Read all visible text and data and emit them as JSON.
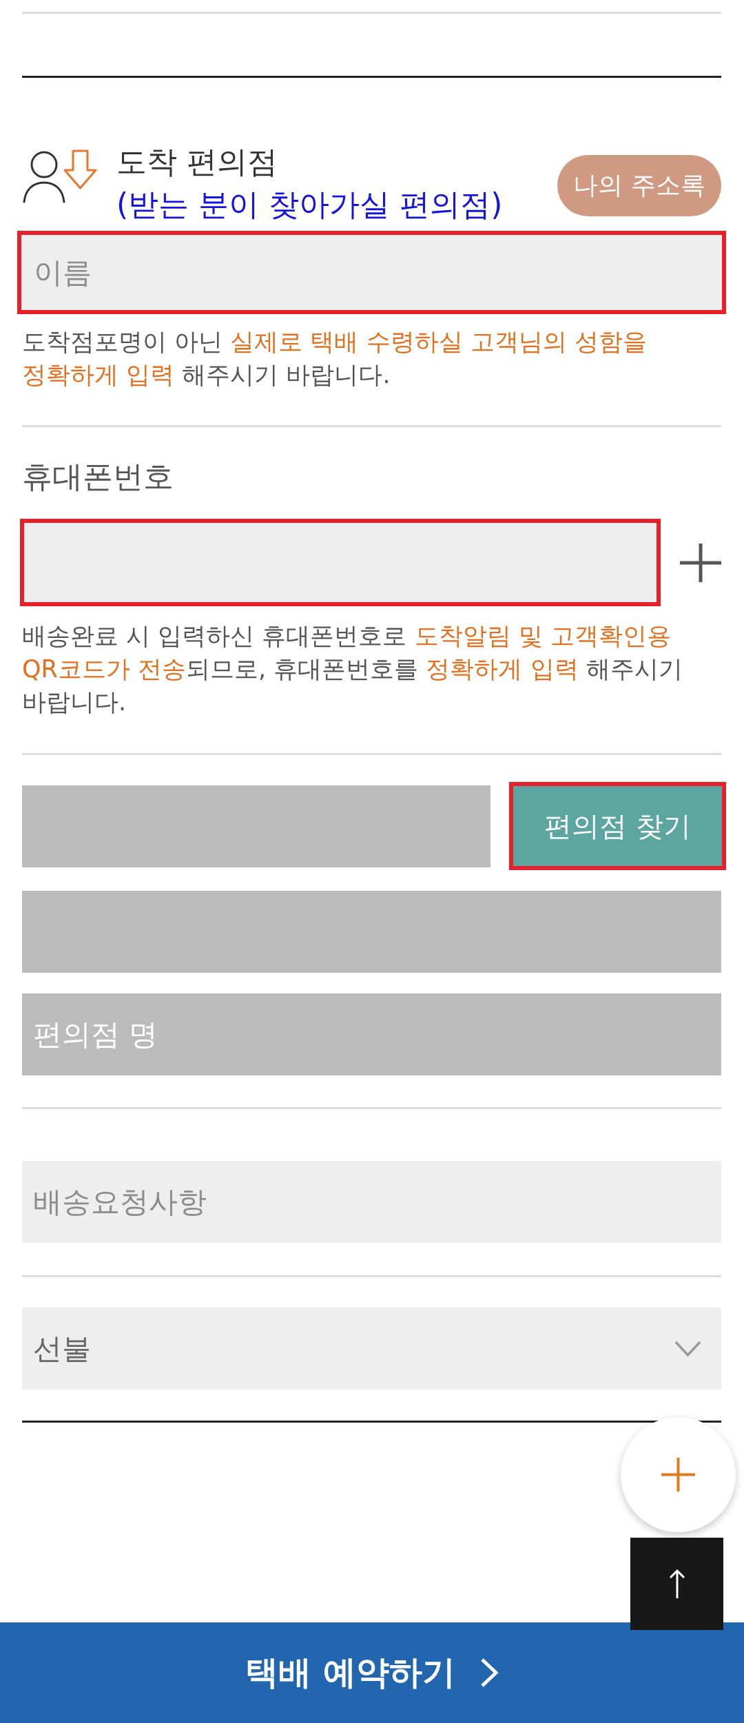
{
  "section": {
    "title": "도착 편의점",
    "subtitle": "(받는 분이 찾아가실 편의점)",
    "address_book_button": "나의 주소록"
  },
  "name_field": {
    "placeholder": "이름",
    "highlighted": true
  },
  "name_notice": [
    {
      "text": "도착점포명이 아닌 ",
      "highlight": false
    },
    {
      "text": "실제로 택배 수령하실 고객님의 성함을 정확하게 입력",
      "highlight": true
    },
    {
      "text": " 해주시기 바랍니다.",
      "highlight": false
    }
  ],
  "phone": {
    "label": "휴대폰번호",
    "field": {
      "highlighted": true
    }
  },
  "phone_notice": [
    {
      "text": "배송완료 시 입력하신 휴대폰번호로 ",
      "highlight": false
    },
    {
      "text": "도착알림 및 고객확인용 QR코드가 전송",
      "highlight": true
    },
    {
      "text": "되므로, 휴대폰번호를 ",
      "highlight": false
    },
    {
      "text": "정확하게 입력",
      "highlight": true
    },
    {
      "text": " 해주시기 바랍니다.",
      "highlight": false
    }
  ],
  "store_search": {
    "button": {
      "label": "편의점 찾기",
      "highlighted": true
    },
    "fields": [
      {
        "disabled": true
      },
      {
        "disabled": true
      },
      {
        "disabled": true,
        "placeholder": "편의점 명"
      }
    ]
  },
  "request_field": {
    "placeholder": "배송요청사항"
  },
  "payment_select": {
    "value": "선불"
  },
  "submit_button": {
    "label": "택배 예약하기"
  }
}
